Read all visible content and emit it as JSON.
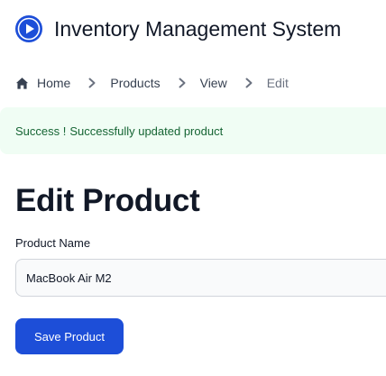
{
  "header": {
    "logo_icon": "play-circle-icon",
    "title": "Inventory Management System"
  },
  "breadcrumb": {
    "items": [
      {
        "label": "Home",
        "icon": "home-icon"
      },
      {
        "label": "Products"
      },
      {
        "label": "View"
      },
      {
        "label": "Edit"
      }
    ],
    "separator_icon": "chevron-right-icon"
  },
  "alert": {
    "title": "Success !",
    "message": "Successfully updated product"
  },
  "main": {
    "title": "Edit Product"
  },
  "form": {
    "product_name_label": "Product Name",
    "product_name_value": "MacBook Air M2",
    "save_label": "Save Product"
  },
  "colors": {
    "brand": "#1d4ed8",
    "alert_bg": "#f0fdf4",
    "alert_text": "#166534"
  }
}
